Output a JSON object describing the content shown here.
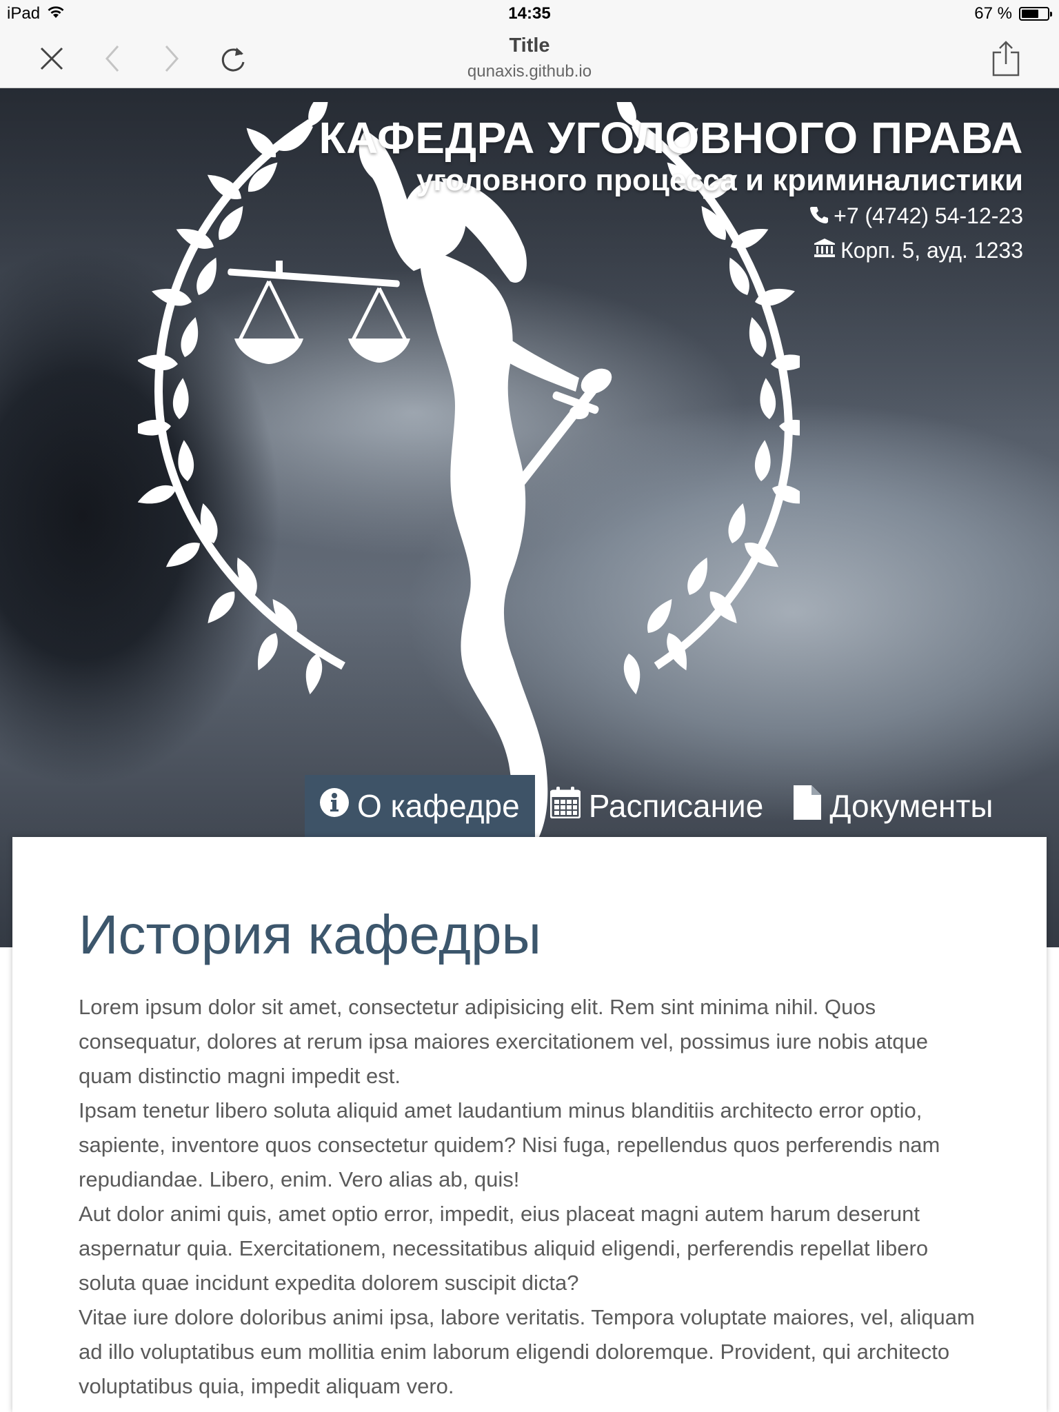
{
  "status_bar": {
    "device": "iPad",
    "time": "14:35",
    "battery": "67 %",
    "battery_level": 0.67
  },
  "browser": {
    "title": "Title",
    "url": "qunaxis.github.io",
    "icons": [
      "close-icon",
      "back-icon",
      "forward-icon",
      "reload-icon",
      "share-icon"
    ]
  },
  "hero": {
    "title": "КАФЕДРА УГОЛОВНОГО ПРАВА",
    "subtitle": "уголовного процесса и криминалистики",
    "phone": "+7 (4742) 54-12-23",
    "room": "Корп. 5, ауд. 1233"
  },
  "tabs": [
    {
      "label": "О кафедре",
      "icon": "info-icon",
      "active": true
    },
    {
      "label": "Расписание",
      "icon": "calendar-icon",
      "active": false
    },
    {
      "label": "Документы",
      "icon": "document-icon",
      "active": false
    }
  ],
  "content": {
    "heading": "История кафедры",
    "paragraphs": [
      "Lorem ipsum dolor sit amet, consectetur adipisicing elit. Rem sint minima nihil. Quos consequatur, dolores at rerum ipsa maiores exercitationem vel, possimus iure nobis atque quam distinctio magni impedit est.",
      "Ipsam tenetur libero soluta aliquid amet laudantium minus blanditiis architecto error optio, sapiente, inventore quos consectetur quidem? Nisi fuga, repellendus quos perferendis nam repudiandae. Libero, enim. Vero alias ab, quis!",
      "Aut dolor animi quis, amet optio error, impedit, eius placeat magni autem harum deserunt aspernatur quia. Exercitationem, necessitatibus aliquid eligendi, perferendis repellat libero soluta quae incidunt expedita dolorem suscipit dicta?",
      "Vitae iure dolore doloribus animi ipsa, labore veritatis. Tempora voluptate maiores, vel, aliquam ad illo voluptatibus eum mollitia enim laborum eligendi doloremque. Provident, qui architecto voluptatibus quia, impedit aliquam vero."
    ]
  },
  "colors": {
    "accent": "#3e5367",
    "heading": "#3c566c",
    "body_text": "#5a5a5a"
  }
}
